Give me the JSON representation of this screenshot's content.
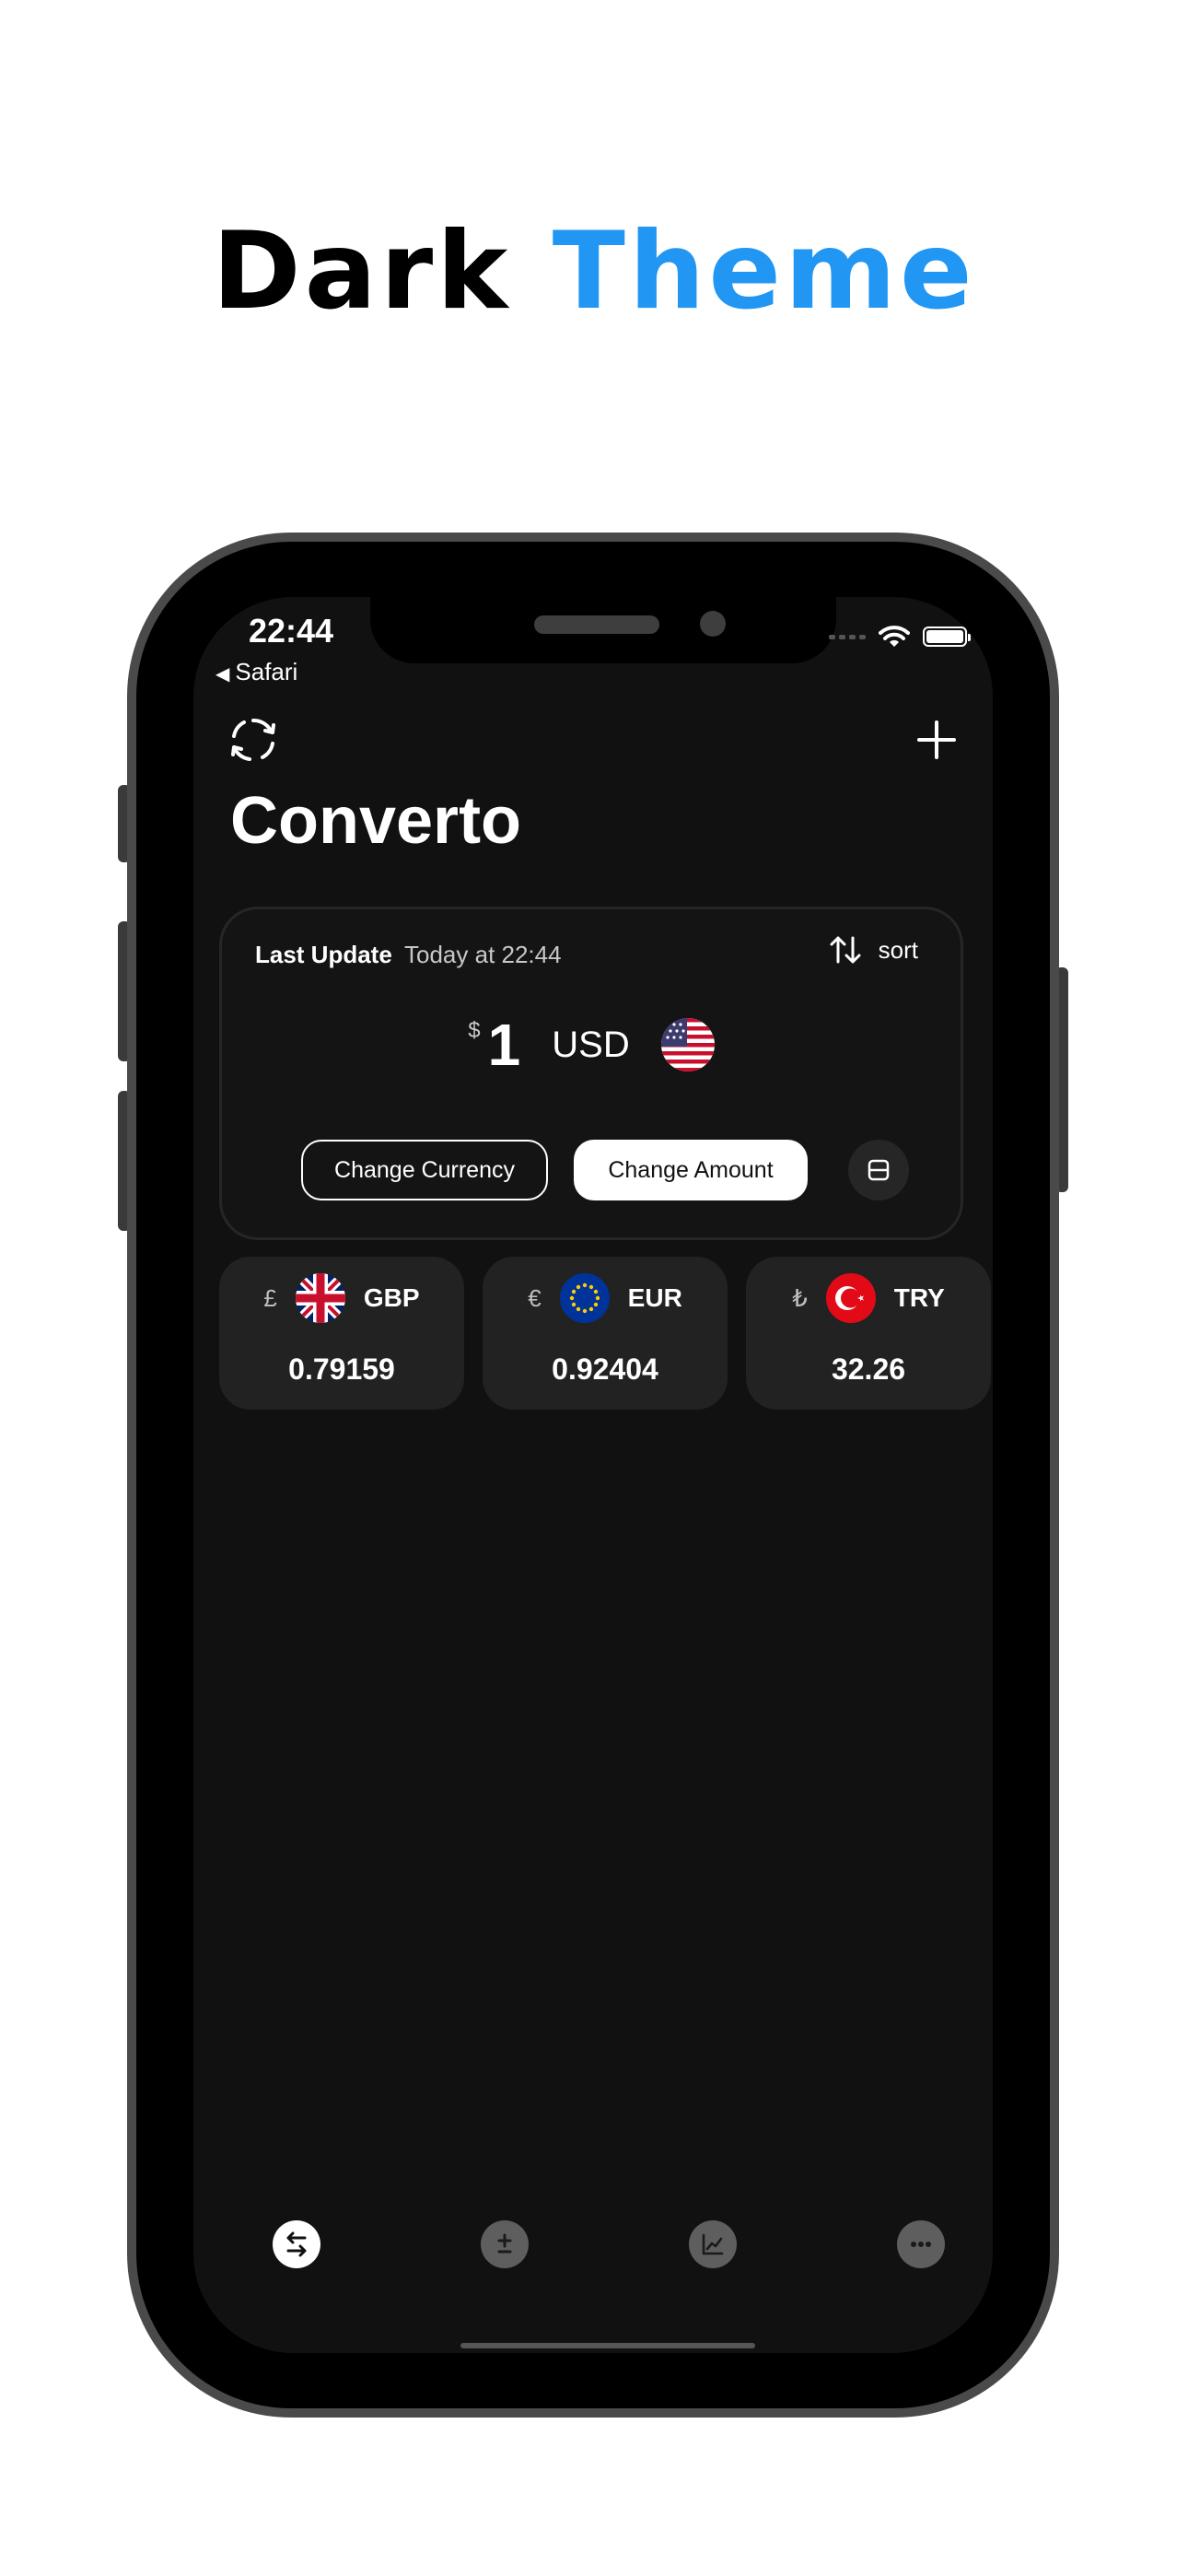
{
  "headline": {
    "word1": "Dark",
    "word2": "Theme"
  },
  "status_bar": {
    "time": "22:44",
    "back_label": "Safari"
  },
  "app": {
    "title": "Converto"
  },
  "main_card": {
    "last_update_label": "Last Update",
    "last_update_value": "Today at 22:44",
    "sort_label": "sort",
    "currency_symbol": "$",
    "amount": "1",
    "currency_code": "USD",
    "flag_icon": "us-flag-icon",
    "change_currency_label": "Change Currency",
    "change_amount_label": "Change Amount"
  },
  "rates": [
    {
      "symbol": "£",
      "code": "GBP",
      "value": "0.79159",
      "flag_icon": "uk-flag-icon"
    },
    {
      "symbol": "€",
      "code": "EUR",
      "value": "0.92404",
      "flag_icon": "eu-flag-icon"
    },
    {
      "symbol": "₺",
      "code": "TRY",
      "value": "32.26",
      "flag_icon": "turkey-flag-icon"
    }
  ],
  "tabs": [
    {
      "icon": "convert-icon",
      "active": true
    },
    {
      "icon": "plus-minus-icon",
      "active": false
    },
    {
      "icon": "chart-icon",
      "active": false
    },
    {
      "icon": "more-icon",
      "active": false
    }
  ],
  "colors": {
    "accent": "#2196F3",
    "screen_bg": "#111111",
    "card_bg": "#222222",
    "text": "#ffffff"
  }
}
